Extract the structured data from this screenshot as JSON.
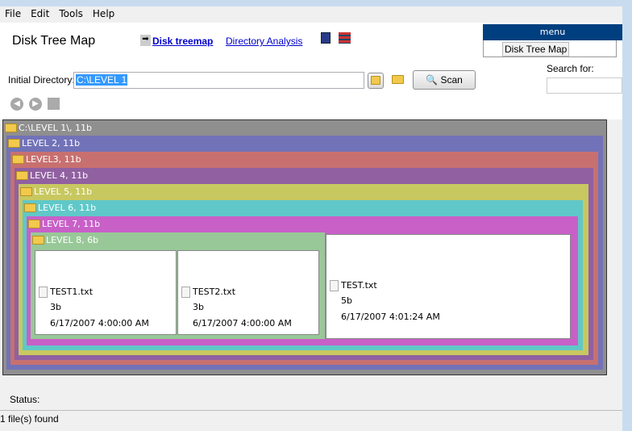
{
  "menu": [
    "File",
    "Edit",
    "Tools",
    "Help"
  ],
  "header": {
    "title": "Disk Tree Map",
    "tab_active": "Disk treemap",
    "tab_other": "Directory Analysis"
  },
  "side": {
    "header": "menu",
    "tree_item": "Disk Tree Map",
    "search_label": "Search for:",
    "search_value": ""
  },
  "dir": {
    "label": "Initial Directory:",
    "value": "C:\\LEVEL 1",
    "scan": "Scan"
  },
  "treemap": {
    "levels": [
      "C:\\LEVEL 1\\, 11b",
      "LEVEL 2, 11b",
      "LEVEL3, 11b",
      "LEVEL 4, 11b",
      "LEVEL 5, 11b",
      "LEVEL 6, 11b",
      "LEVEL 7, 11b",
      "LEVEL 8, 6b"
    ],
    "colors": [
      "#8f8f8f",
      "#7272b8",
      "#c87070",
      "#9060a0",
      "#c8c860",
      "#60c8c8",
      "#c860c8",
      "#98c898"
    ],
    "files": [
      {
        "name": "TEST1.txt",
        "size": "3b",
        "date": "6/17/2007 4:00:00 AM"
      },
      {
        "name": "TEST2.txt",
        "size": "3b",
        "date": "6/17/2007 4:00:00 AM"
      },
      {
        "name": "TEST.txt",
        "size": "5b",
        "date": "6/17/2007 4:01:24 AM"
      }
    ]
  },
  "status": {
    "label": "Status:",
    "bar": "1 file(s) found"
  }
}
